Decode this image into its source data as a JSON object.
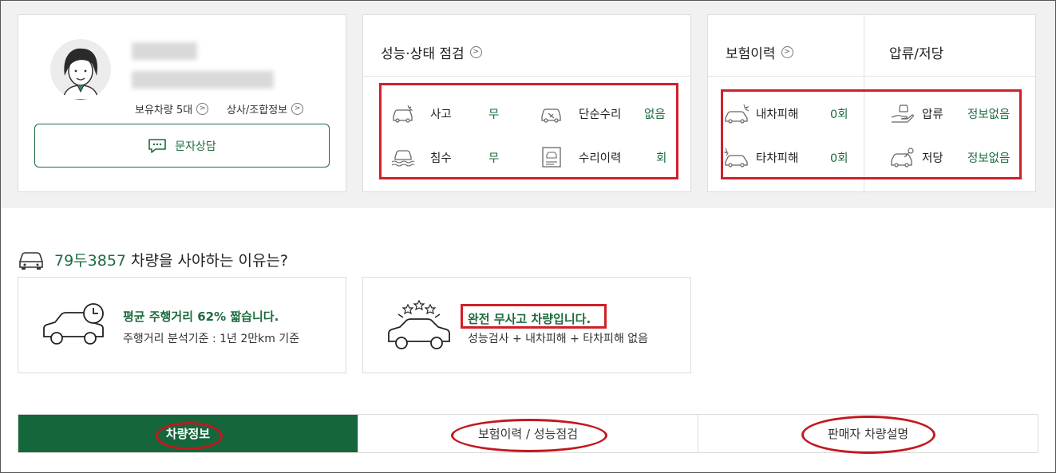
{
  "seller": {
    "owned_vehicles": "보유차량 5대",
    "company_info": "상사/조합정보",
    "sms_label": "문자상담"
  },
  "inspection": {
    "title": "성능·상태 점검",
    "items": [
      {
        "label": "사고",
        "value": "무",
        "icon": "car-accident-icon"
      },
      {
        "label": "단순수리",
        "value": "없음",
        "icon": "car-repair-icon"
      },
      {
        "label": "침수",
        "value": "무",
        "icon": "car-flood-icon"
      },
      {
        "label": "수리이력",
        "value": "회",
        "icon": "repair-document-icon"
      }
    ]
  },
  "insurance": {
    "title": "보험이력",
    "items": [
      {
        "label": "내차피해",
        "value": "0회",
        "icon": "my-car-damage-icon"
      },
      {
        "label": "타차피해",
        "value": "0회",
        "icon": "other-car-damage-icon"
      }
    ]
  },
  "seizure": {
    "title": "압류/저당",
    "items": [
      {
        "label": "압류",
        "value": "정보없음",
        "icon": "seizure-hand-icon"
      },
      {
        "label": "저당",
        "value": "정보없음",
        "icon": "mortgage-key-icon"
      }
    ]
  },
  "reasons": {
    "plate": "79두3857",
    "heading_rest": " 차량을 사야하는 이유는?",
    "cards": [
      {
        "title": "평균 주행거리 62% 짧습니다.",
        "sub": "주행거리 분석기준 : 1년 2만km 기준",
        "icon": "car-clock-icon"
      },
      {
        "title": "완전 무사고 차량입니다.",
        "sub": "성능검사 + 내차피해 + 타차피해 없음",
        "icon": "car-stars-icon"
      }
    ]
  },
  "tabs": [
    {
      "label": "차량정보",
      "active": true
    },
    {
      "label": "보험이력 / 성능점검",
      "active": false
    },
    {
      "label": "판매자 차량설명",
      "active": false
    }
  ],
  "colors": {
    "accent": "#1d6b3e",
    "tab_active_bg": "#15663b",
    "annotation_red": "#d0202a"
  }
}
